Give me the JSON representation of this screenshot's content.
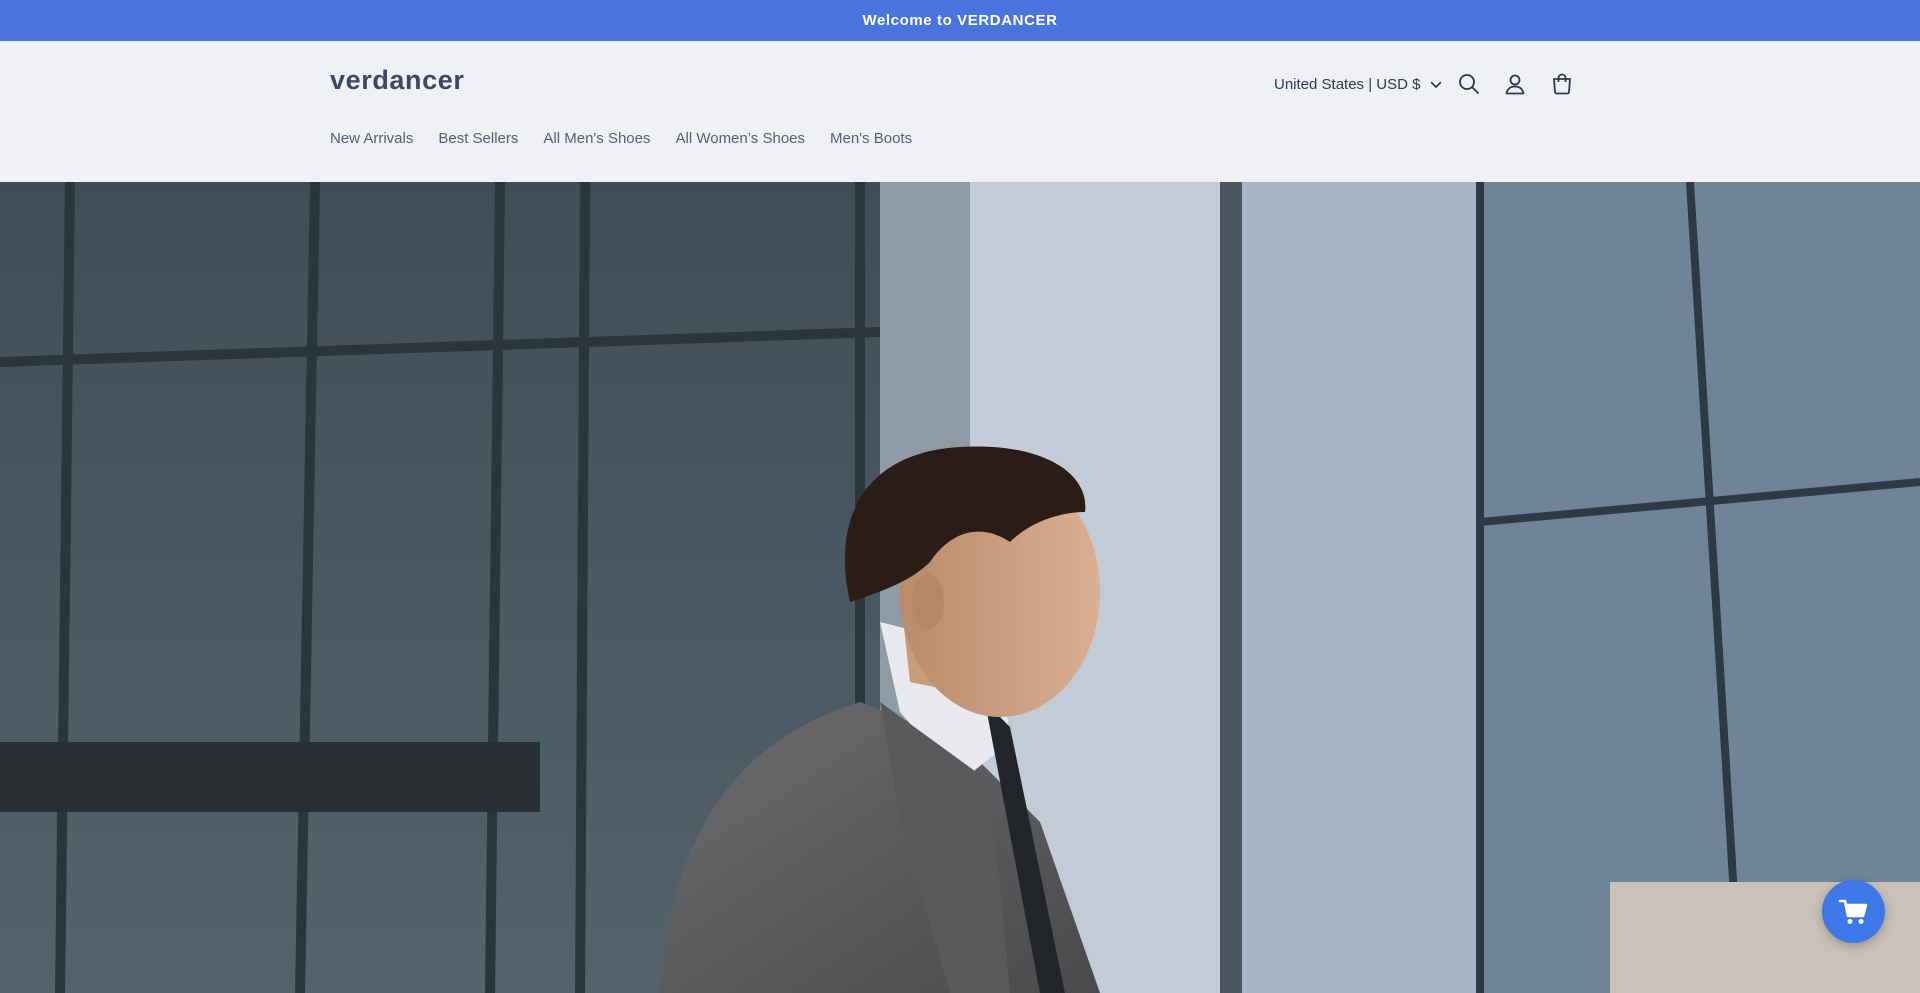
{
  "announcement": {
    "text": "Welcome to VERDANCER"
  },
  "header": {
    "logo": "verdancer",
    "country_selector": "United States | USD $",
    "icons": [
      "search-icon",
      "account-icon",
      "cart-icon"
    ]
  },
  "nav": {
    "items": [
      {
        "label": "New Arrivals"
      },
      {
        "label": "Best Sellers"
      },
      {
        "label": "All Men's Shoes"
      },
      {
        "label": "All Women’s Shoes"
      },
      {
        "label": "Men's Boots"
      }
    ]
  },
  "hero": {
    "image": "man-in-suit-walking-past-glass-buildings"
  },
  "floating_cart": {
    "icon": "shopping-cart-icon"
  },
  "colors": {
    "announcement_bg": "#4a74dd",
    "header_bg": "#f0f1f5",
    "text": "#3c4563",
    "float_button": "#3e78e6"
  }
}
